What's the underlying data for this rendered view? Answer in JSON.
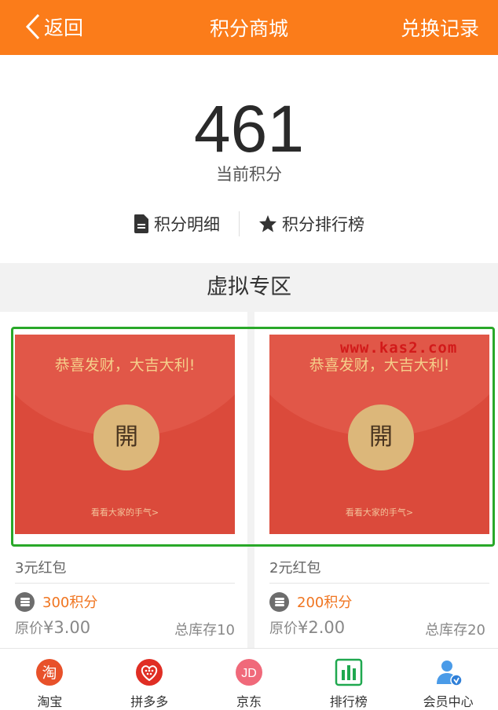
{
  "header": {
    "back_label": "返回",
    "title": "积分商城",
    "record_label": "兑换记录"
  },
  "points": {
    "value": "461",
    "label": "当前积分",
    "detail_label": "积分明细",
    "ranking_label": "积分排行榜"
  },
  "section": {
    "title": "虚拟专区"
  },
  "products": [
    {
      "greeting": "恭喜发财，大吉大利!",
      "open_char": "開",
      "see_text": "看看大家的手气>",
      "name": "3元红包",
      "points": "300积分",
      "original_prefix": "原价",
      "original_price": "¥3.00",
      "stock": "总库存10"
    },
    {
      "greeting": "恭喜发财，大吉大利!",
      "open_char": "開",
      "see_text": "看看大家的手气>",
      "name": "2元红包",
      "points": "200积分",
      "original_prefix": "原价",
      "original_price": "¥2.00",
      "stock": "总库存20"
    }
  ],
  "watermark": "www.kas2.com",
  "tabbar": [
    {
      "label": "淘宝",
      "icon": "taobao-icon",
      "icon_text": "淘"
    },
    {
      "label": "拼多多",
      "icon": "pinduoduo-icon"
    },
    {
      "label": "京东",
      "icon": "jd-icon",
      "icon_text": "JD"
    },
    {
      "label": "排行榜",
      "icon": "ranking-chart-icon"
    },
    {
      "label": "会员中心",
      "icon": "member-icon"
    }
  ],
  "colors": {
    "brand": "#fb7c1a",
    "points_text": "#f07520",
    "envelope": "#db4a3b",
    "highlight_box": "#29a829"
  }
}
